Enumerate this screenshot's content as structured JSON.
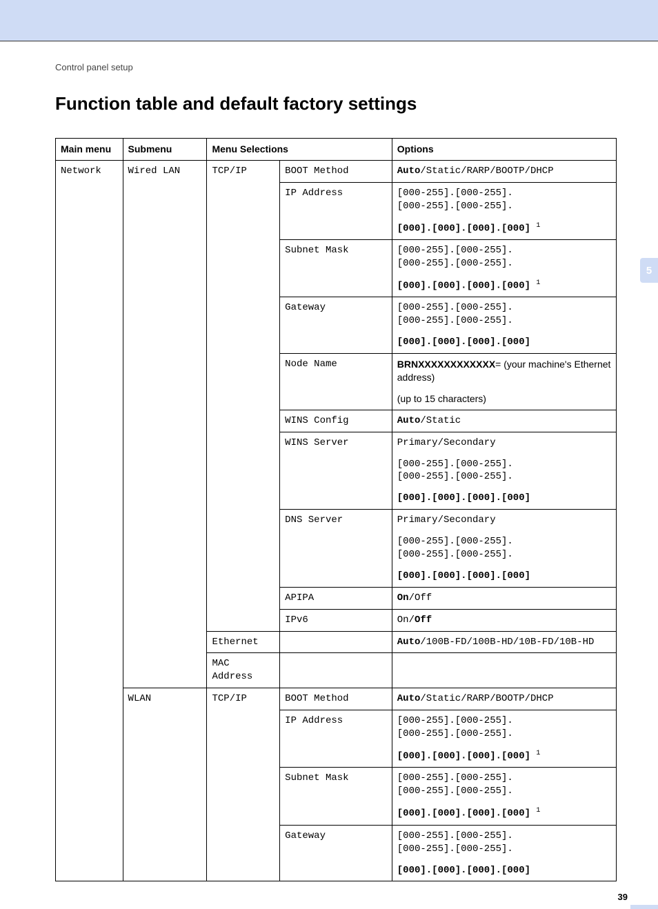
{
  "breadcrumb": "Control panel setup",
  "heading": "Function table and default factory settings",
  "side_tab": "5",
  "page_number": "39",
  "headers": {
    "main": "Main menu",
    "sub": "Submenu",
    "sel": "Menu Selections",
    "opt": "Options"
  },
  "labels": {
    "network": "Network",
    "wired": "Wired LAN",
    "wlan": "WLAN",
    "tcpip": "TCP/IP",
    "ethernet": "Ethernet",
    "mac": "MAC Address",
    "boot": "BOOT Method",
    "ip": "IP Address",
    "subnet": "Subnet Mask",
    "gateway": "Gateway",
    "node": "Node Name",
    "winscfg": "WINS Config",
    "winssrv": "WINS Server",
    "dnssrv": "DNS Server",
    "apipa": "APIPA",
    "ipv6": "IPv6"
  },
  "opts": {
    "boot_auto": "Auto",
    "boot_rest": "/Static/RARP/BOOTP/DHCP",
    "ip_range": "[000-255].[000-255].\n[000-255].[000-255].",
    "ip_zero": "[000].[000].[000].[000]",
    "footnote": "1",
    "brn_bold": "BRNXXXXXXXXXXXX",
    "brn_rest": "= (your machine's Ethernet address)",
    "upto15": "(up to 15 characters)",
    "auto": "Auto",
    "static": "/Static",
    "prim": "Primary",
    "sec": "/Secondary",
    "on": "On",
    "off_mono": "/Off",
    "on_mono": "On/",
    "off_bold": "Off",
    "eth_auto": "Auto",
    "eth_rest": "/100B-FD/100B-HD/10B-FD/10B-HD"
  }
}
